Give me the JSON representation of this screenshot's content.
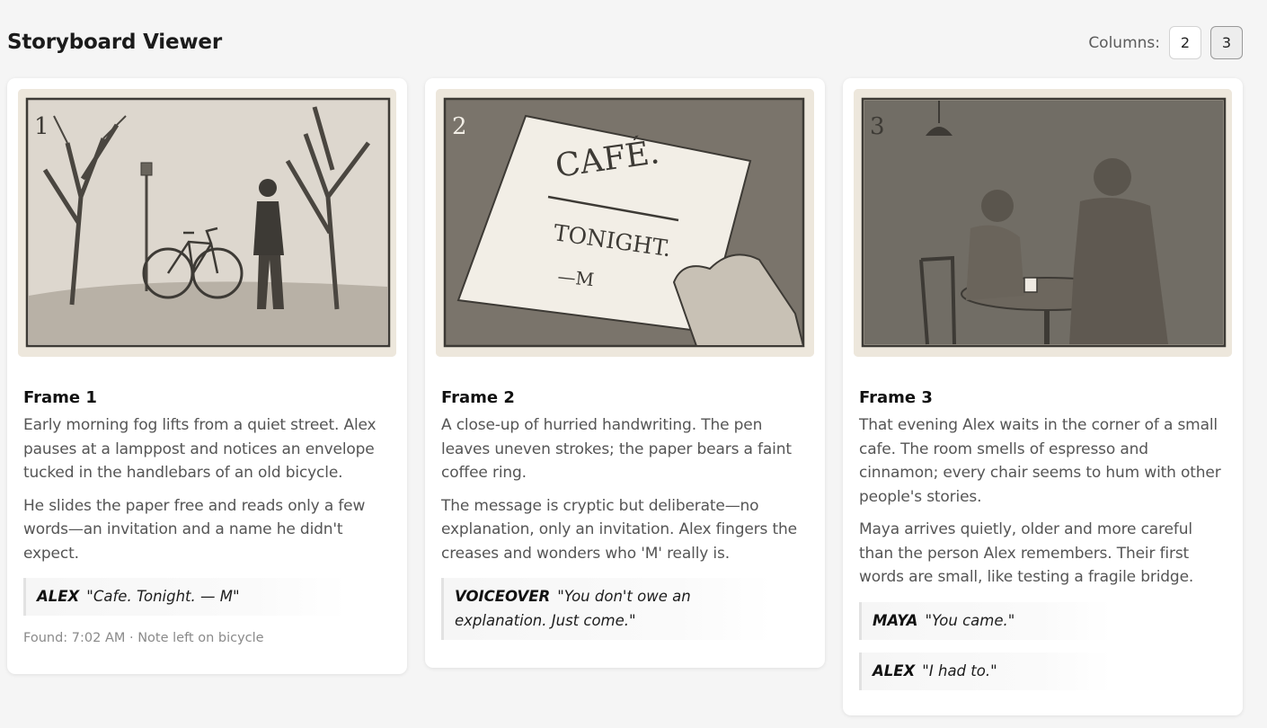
{
  "app": {
    "title": "Storyboard Viewer",
    "columns_label": "Columns:",
    "column_options": [
      "2",
      "3"
    ],
    "selected_columns": "3"
  },
  "frames": [
    {
      "number": "1",
      "title": "Frame 1",
      "paragraphs": [
        "Early morning fog lifts from a quiet street. Alex pauses at a lamppost and notices an envelope tucked in the handlebars of an old bicycle.",
        "He slides the paper free and reads only a few words—an invitation and a name he didn't expect."
      ],
      "dialogue": [
        {
          "speaker": "ALEX",
          "line": "\"Cafe. Tonight. — M\""
        }
      ],
      "meta": "Found: 7:02 AM · Note left on bicycle"
    },
    {
      "number": "2",
      "title": "Frame 2",
      "note_lines": [
        "CAFÉ.",
        "TONIGHT.",
        "—M"
      ],
      "paragraphs": [
        "A close-up of hurried handwriting. The pen leaves uneven strokes; the paper bears a faint coffee ring.",
        "The message is cryptic but deliberate—no explanation, only an invitation. Alex fingers the creases and wonders who 'M' really is."
      ],
      "dialogue": [
        {
          "speaker": "VOICEOVER",
          "line": "\"You don't owe an explanation. Just come.\""
        }
      ]
    },
    {
      "number": "3",
      "title": "Frame 3",
      "paragraphs": [
        "That evening Alex waits in the corner of a small cafe. The room smells of espresso and cinnamon; every chair seems to hum with other people's stories.",
        "Maya arrives quietly, older and more careful than the person Alex remembers. Their first words are small, like testing a fragile bridge."
      ],
      "dialogue": [
        {
          "speaker": "MAYA",
          "line": "\"You came.\""
        },
        {
          "speaker": "ALEX",
          "line": "\"I had to.\""
        }
      ]
    }
  ],
  "colors": {
    "page_bg": "#f5f5f5",
    "card_bg": "#ffffff",
    "sketch_paper": "#ede7dc",
    "sketch_ink": "#4a4640"
  }
}
